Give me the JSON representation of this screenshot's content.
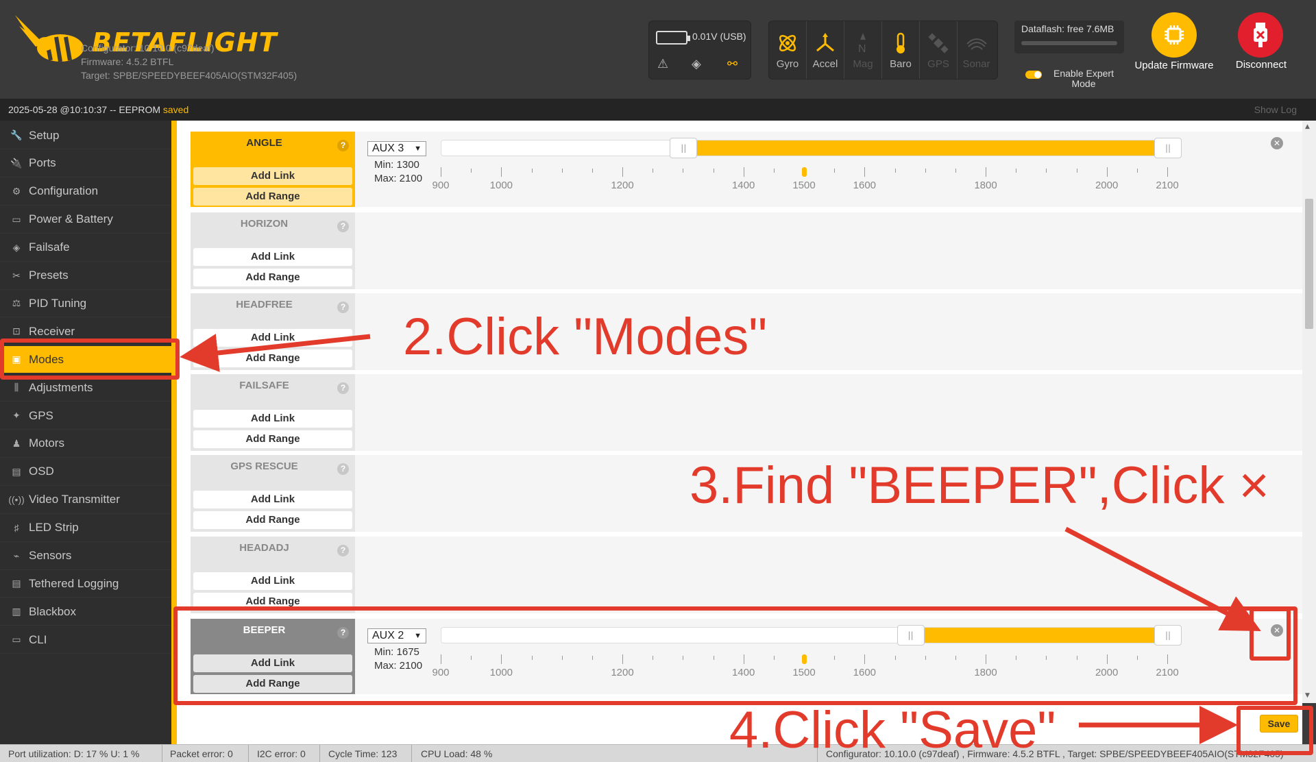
{
  "header": {
    "brand": "BETAFLIGHT",
    "configurator": "Configurator: 10.10.0 (c97deaf)",
    "firmware": "Firmware: 4.5.2 BTFL",
    "target": "Target: SPBE/SPEEDYBEEF405AIO(STM32F405)",
    "battery": "0.01V (USB)",
    "sensors": [
      {
        "label": "Gyro",
        "icon": "gyro-icon",
        "active": true
      },
      {
        "label": "Accel",
        "icon": "accel-icon",
        "active": true
      },
      {
        "label": "Mag",
        "icon": "mag-icon",
        "active": false
      },
      {
        "label": "Baro",
        "icon": "baro-icon",
        "active": true
      },
      {
        "label": "GPS",
        "icon": "gps-icon",
        "active": false
      },
      {
        "label": "Sonar",
        "icon": "sonar-icon",
        "active": false
      }
    ],
    "dataflash": "Dataflash: free 7.6MB",
    "expert_mode": "Enable Expert Mode",
    "update_firmware": "Update Firmware",
    "disconnect": "Disconnect",
    "accent_color": "#ffbb00",
    "disconnect_color": "#e2202d"
  },
  "statusbar": {
    "text": "2025-05-28 @10:10:37 -- EEPROM",
    "saved": "saved",
    "show_log": "Show Log"
  },
  "sidebar": {
    "items": [
      {
        "label": "Setup",
        "icon": "wrench-icon"
      },
      {
        "label": "Ports",
        "icon": "plug-icon"
      },
      {
        "label": "Configuration",
        "icon": "gear-icon"
      },
      {
        "label": "Power & Battery",
        "icon": "battery-icon"
      },
      {
        "label": "Failsafe",
        "icon": "parachute-icon"
      },
      {
        "label": "Presets",
        "icon": "tools-icon"
      },
      {
        "label": "PID Tuning",
        "icon": "pid-icon"
      },
      {
        "label": "Receiver",
        "icon": "receiver-icon"
      },
      {
        "label": "Modes",
        "icon": "modes-icon",
        "active": true
      },
      {
        "label": "Adjustments",
        "icon": "sliders-icon"
      },
      {
        "label": "GPS",
        "icon": "satellite-icon"
      },
      {
        "label": "Motors",
        "icon": "motor-icon"
      },
      {
        "label": "OSD",
        "icon": "osd-icon"
      },
      {
        "label": "Video Transmitter",
        "icon": "antenna-icon"
      },
      {
        "label": "LED Strip",
        "icon": "led-icon"
      },
      {
        "label": "Sensors",
        "icon": "sensors-icon"
      },
      {
        "label": "Tethered Logging",
        "icon": "logging-icon"
      },
      {
        "label": "Blackbox",
        "icon": "blackbox-icon"
      },
      {
        "label": "CLI",
        "icon": "cli-icon"
      }
    ]
  },
  "modes": {
    "add_link": "Add Link",
    "add_range": "Add Range",
    "help": "?",
    "ticks": [
      "900",
      "1000",
      "1200",
      "1400",
      "1500",
      "1600",
      "1800",
      "2000",
      "2100"
    ],
    "list": [
      {
        "name": "ANGLE",
        "aux": "AUX 3",
        "min": "Min: 1300",
        "max": "Max: 2100",
        "range_min": 1300,
        "range_max": 2100,
        "channel_value": 1500
      },
      {
        "name": "HORIZON"
      },
      {
        "name": "HEADFREE"
      },
      {
        "name": "FAILSAFE"
      },
      {
        "name": "GPS RESCUE"
      },
      {
        "name": "HEADADJ"
      },
      {
        "name": "BEEPER",
        "aux": "AUX 2",
        "min": "Min: 1675",
        "max": "Max: 2100",
        "range_min": 1675,
        "range_max": 2100,
        "channel_value": 1500
      }
    ],
    "save": "Save"
  },
  "footer": {
    "port_util": "Port utilization: D: 17 % U: 1 %",
    "packet_error": "Packet error: 0",
    "i2c_error": "I2C error: 0",
    "cycle_time": "Cycle Time: 123",
    "cpu_load": "CPU Load: 48 %",
    "version": "Configurator: 10.10.0 (c97deaf) , Firmware: 4.5.2 BTFL , Target: SPBE/SPEEDYBEEF405AIO(STM32F405)"
  },
  "annotations": {
    "step2": "2.Click \"Modes\"",
    "step3": "3.Find \"BEEPER\",Click ×",
    "step4": "4.Click \"Save\"",
    "color": "#e23b2c"
  }
}
